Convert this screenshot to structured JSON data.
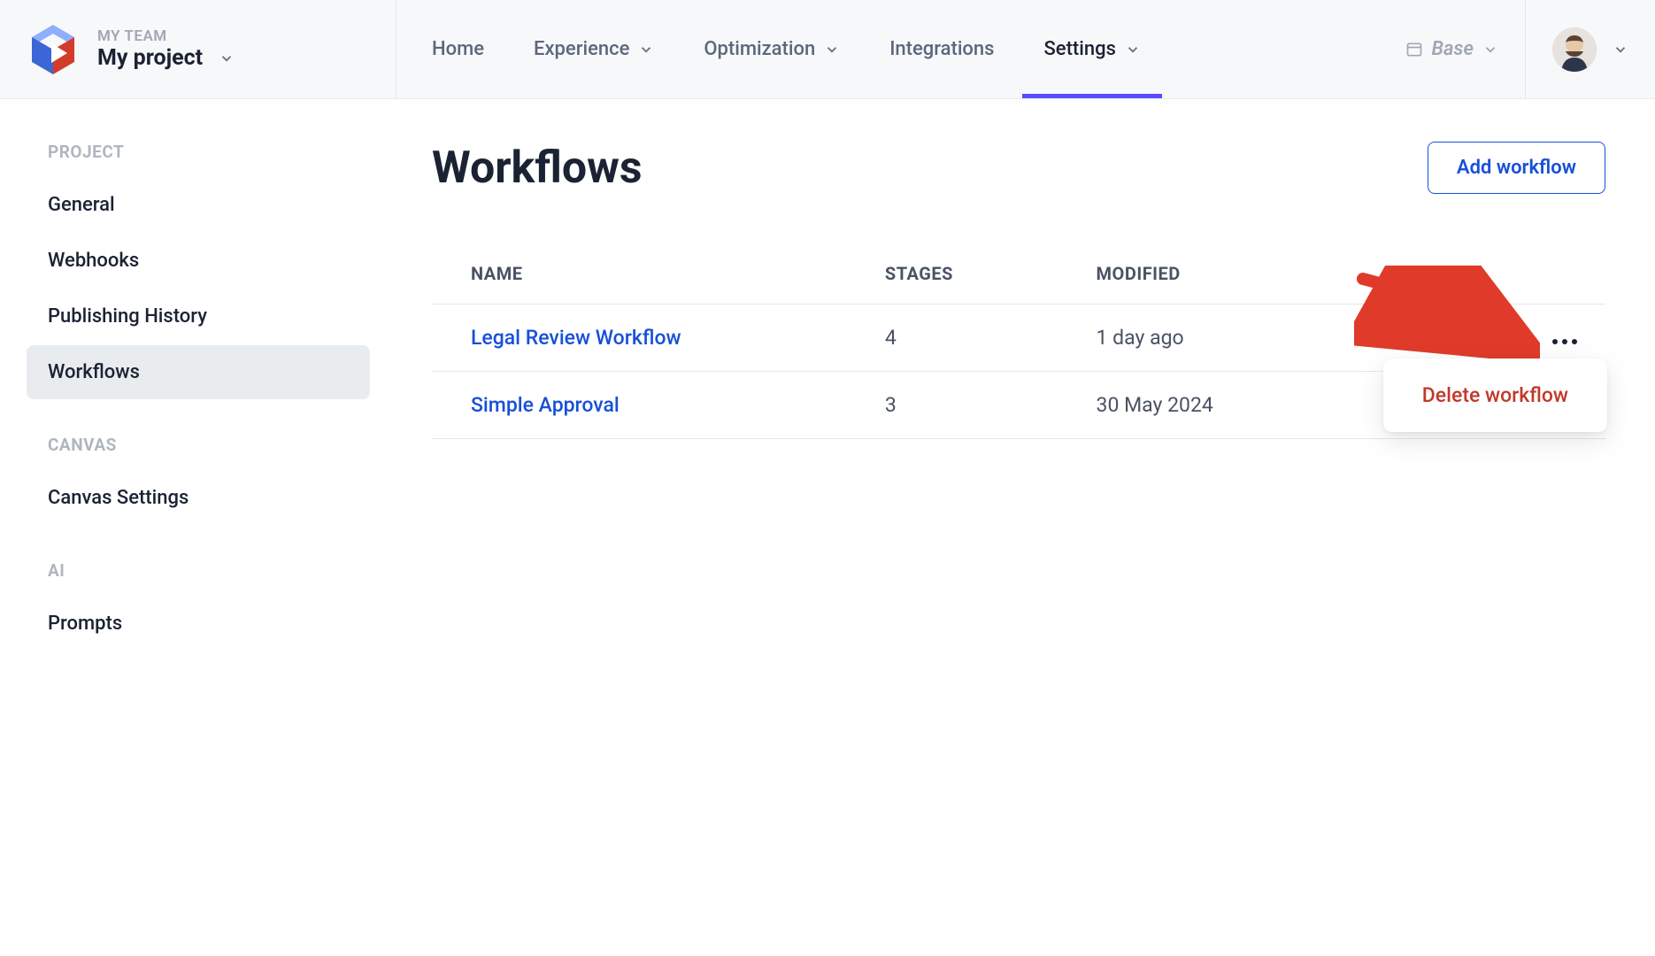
{
  "header": {
    "team_label": "MY TEAM",
    "project_name": "My project",
    "nav": {
      "home": "Home",
      "experience": "Experience",
      "optimization": "Optimization",
      "integrations": "Integrations",
      "settings": "Settings"
    },
    "base_label": "Base"
  },
  "sidebar": {
    "sections": {
      "project": {
        "heading": "PROJECT",
        "items": [
          "General",
          "Webhooks",
          "Publishing History",
          "Workflows"
        ]
      },
      "canvas": {
        "heading": "CANVAS",
        "items": [
          "Canvas Settings"
        ]
      },
      "ai": {
        "heading": "AI",
        "items": [
          "Prompts"
        ]
      }
    }
  },
  "main": {
    "title": "Workflows",
    "add_label": "Add workflow",
    "columns": {
      "name": "NAME",
      "stages": "STAGES",
      "modified": "MODIFIED"
    },
    "rows": [
      {
        "name": "Legal Review Workflow",
        "stages": "4",
        "modified": "1 day ago"
      },
      {
        "name": "Simple Approval",
        "stages": "3",
        "modified": "30 May 2024"
      }
    ],
    "context_menu": {
      "delete": "Delete workflow"
    }
  }
}
